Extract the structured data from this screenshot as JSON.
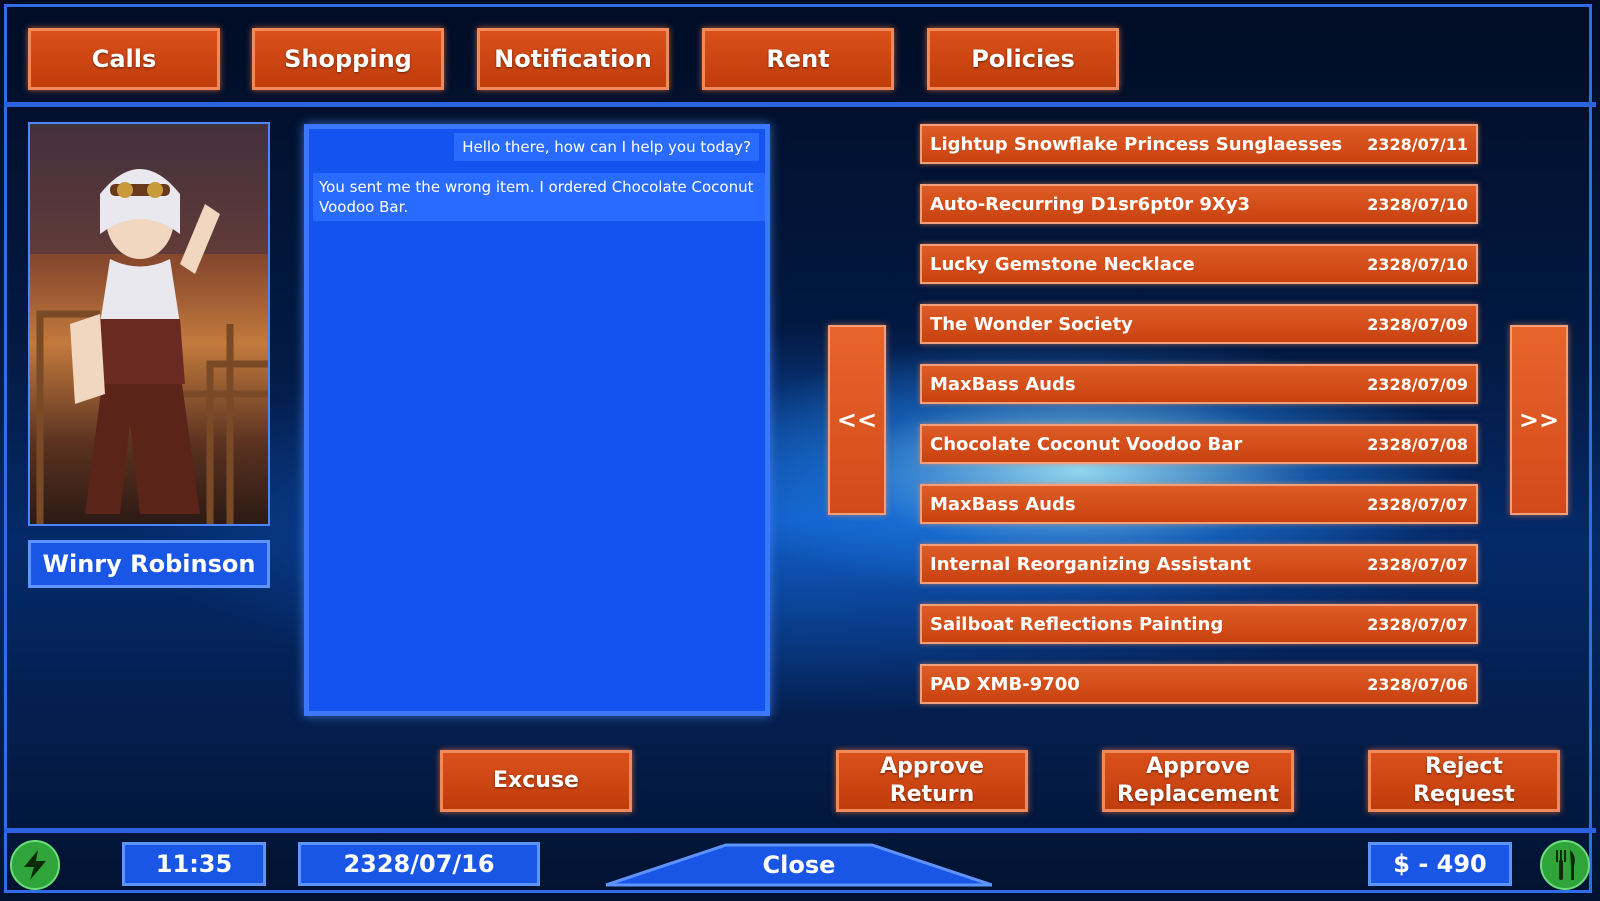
{
  "nav": {
    "calls": "Calls",
    "shopping": "Shopping",
    "notification": "Notification",
    "rent": "Rent",
    "policies": "Policies"
  },
  "customer": {
    "name": "Winry Robinson"
  },
  "chat": {
    "npc_message": "Hello there, how can I help you today?",
    "player_message": "You sent me the wrong item. I ordered Chocolate Coconut Voodoo Bar."
  },
  "orders": [
    {
      "name": "Lightup Snowflake Princess Sunglaesses",
      "date": "2328/07/11"
    },
    {
      "name": "Auto-Recurring D1sr6pt0r 9Xy3",
      "date": "2328/07/10"
    },
    {
      "name": "Lucky Gemstone Necklace",
      "date": "2328/07/10"
    },
    {
      "name": "The Wonder Society",
      "date": "2328/07/09"
    },
    {
      "name": "MaxBass Auds",
      "date": "2328/07/09"
    },
    {
      "name": "Chocolate Coconut Voodoo Bar",
      "date": "2328/07/08"
    },
    {
      "name": "MaxBass Auds",
      "date": "2328/07/07"
    },
    {
      "name": "Internal Reorganizing Assistant",
      "date": "2328/07/07"
    },
    {
      "name": "Sailboat Reflections Painting",
      "date": "2328/07/07"
    },
    {
      "name": "PAD XMB-9700",
      "date": "2328/07/06"
    }
  ],
  "pager": {
    "prev": "<<",
    "next": ">>"
  },
  "actions": {
    "excuse": "Excuse",
    "approve_return_1": "Approve",
    "approve_return_2": "Return",
    "approve_replacement_1": "Approve",
    "approve_replacement_2": "Replacement",
    "reject_request_1": "Reject",
    "reject_request_2": "Request"
  },
  "status": {
    "time": "11:35",
    "date": "2328/07/16",
    "close": "Close",
    "money": "$ - 490"
  },
  "icons": {
    "energy": "lightning-icon",
    "food": "fork-knife-icon"
  },
  "colors": {
    "button_orange": "#d9501a",
    "panel_blue": "#1a56e6",
    "border_blue": "#2f6ce8",
    "status_green": "#2ea43a"
  }
}
